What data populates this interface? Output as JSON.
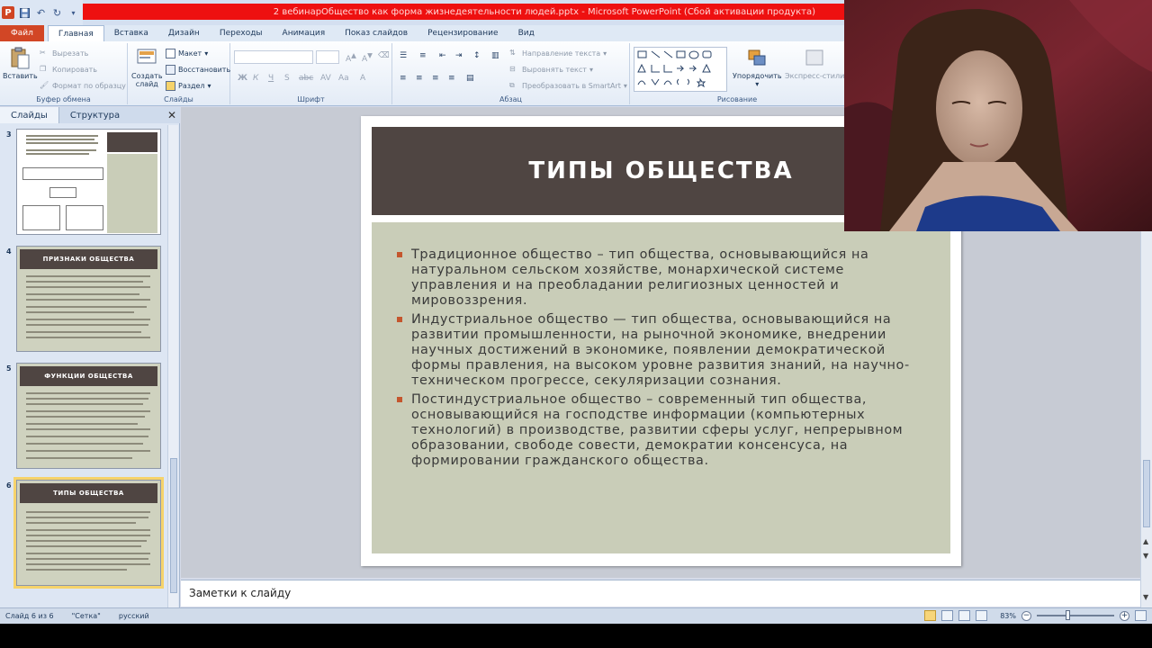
{
  "window": {
    "title": "2 вебинарОбщество как форма жизнедеятельности людей.pptx - Microsoft PowerPoint (Сбой активации продукта)"
  },
  "ribbon_tabs": [
    "Файл",
    "Главная",
    "Вставка",
    "Дизайн",
    "Переходы",
    "Анимация",
    "Показ слайдов",
    "Рецензирование",
    "Вид"
  ],
  "ribbon": {
    "clipboard": {
      "paste": "Вставить",
      "cut": "Вырезать",
      "copy": "Копировать",
      "format_painter": "Формат по образцу",
      "label": "Буфер обмена"
    },
    "slides": {
      "new_slide_line1": "Создать",
      "new_slide_line2": "слайд",
      "layout": "Макет",
      "reset": "Восстановить",
      "section": "Раздел",
      "label": "Слайды"
    },
    "font": {
      "label": "Шрифт"
    },
    "paragraph": {
      "text_direction": "Направление текста",
      "align_text": "Выровнять текст",
      "smartart": "Преобразовать в SmartArt",
      "label": "Абзац"
    },
    "drawing": {
      "arrange": "Упорядочить",
      "quick_styles": "Экспресс-стили",
      "label": "Рисование"
    }
  },
  "left_panel": {
    "tabs": [
      "Слайды",
      "Структура"
    ],
    "thumbnails": [
      {
        "number": "3",
        "title": ""
      },
      {
        "number": "4",
        "title": "ПРИЗНАКИ ОБЩЕСТВА"
      },
      {
        "number": "5",
        "title": "ФУНКЦИИ ОБЩЕСТВА"
      },
      {
        "number": "6",
        "title": "ТИПЫ ОБЩЕСТВА"
      }
    ]
  },
  "slide": {
    "title": "ТИПЫ ОБЩЕСТВА",
    "bullets": [
      "Традиционное общество – тип общества, основывающийся на натуральном сельском хозяйстве, монархической системе управления и на преобладании религиозных ценностей и мировоззрения.",
      "Индустриальное общество — тип общества, основывающийся на развитии промышленности, на рыночной экономике, внедрении научных достижений в экономике, появлении демократической формы правления, на высоком уровне развития знаний, на научно-техническом прогрессе, секуляризации сознания.",
      "Постиндустриальное общество – современный тип общества, основывающийся на господстве информации (компьютерных технологий) в производстве, развитии сферы услуг, непрерывном образовании, свободе совести, демократии консенсуса, на формировании гражданского общества."
    ]
  },
  "notes": {
    "placeholder": "Заметки к слайду"
  },
  "statusbar": {
    "slide_counter": "Слайд 6 из 6",
    "theme": "\"Сетка\"",
    "language": "русский",
    "zoom": "83%",
    "zoom_percent": 83
  },
  "colors": {
    "title_strip": "#ee1010",
    "slide_header": "#4f4542",
    "slide_body": "#c9cdb8",
    "bullet": "#c4562d"
  }
}
